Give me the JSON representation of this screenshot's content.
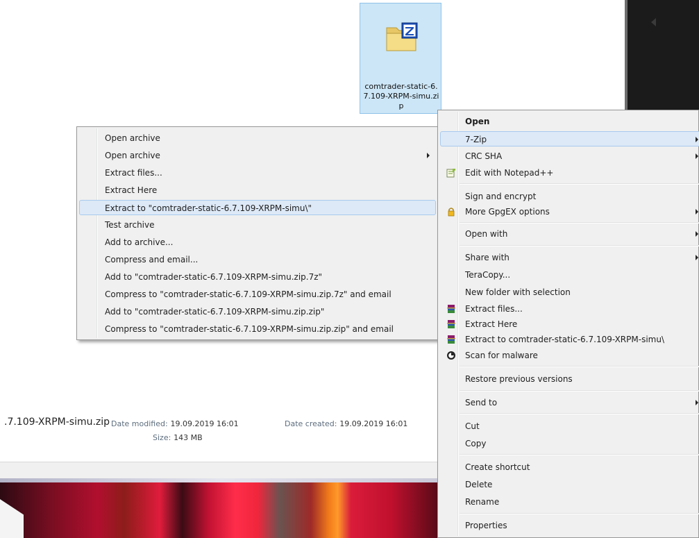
{
  "file": {
    "name": "comtrader-static-6.7.109-XRPM-simu.zip",
    "icon": "zip-archive-icon"
  },
  "details": {
    "name_visible": ".7.109-XRPM-simu.zip",
    "modified_label": "Date modified:",
    "modified_value": "19.09.2019 16:01",
    "created_label": "Date created:",
    "created_value": "19.09.2019 16:01",
    "size_label": "Size:",
    "size_value": "143 MB"
  },
  "context_menu": {
    "items": [
      {
        "label": "Open",
        "bold": true
      },
      {
        "label": "7-Zip",
        "submenu": true,
        "highlighted": true
      },
      {
        "label": "CRC SHA",
        "submenu": true
      },
      {
        "label": "Edit with Notepad++",
        "icon": "notepadpp-icon"
      },
      {
        "label": "Sign and encrypt"
      },
      {
        "label": "More GpgEX options",
        "submenu": true,
        "icon": "lock-icon"
      },
      {
        "label": "Open with",
        "submenu": true
      },
      {
        "label": "Share with",
        "submenu": true
      },
      {
        "label": "TeraCopy..."
      },
      {
        "label": "New folder with selection"
      },
      {
        "label": "Extract files...",
        "icon": "winrar-icon"
      },
      {
        "label": "Extract Here",
        "icon": "winrar-icon"
      },
      {
        "label": "Extract to comtrader-static-6.7.109-XRPM-simu\\",
        "icon": "winrar-icon"
      },
      {
        "label": "Scan for malware",
        "icon": "malwarebytes-icon"
      },
      {
        "label": "Restore previous versions"
      },
      {
        "label": "Send to",
        "submenu": true
      },
      {
        "label": "Cut"
      },
      {
        "label": "Copy"
      },
      {
        "label": "Create shortcut"
      },
      {
        "label": "Delete"
      },
      {
        "label": "Rename"
      },
      {
        "label": "Properties"
      }
    ]
  },
  "submenu_7zip": {
    "items": [
      {
        "label": "Open archive"
      },
      {
        "label": "Open archive",
        "submenu": true
      },
      {
        "label": "Extract files..."
      },
      {
        "label": "Extract Here"
      },
      {
        "label": "Extract to \"comtrader-static-6.7.109-XRPM-simu\\\"",
        "highlighted": true
      },
      {
        "label": "Test archive"
      },
      {
        "label": "Add to archive..."
      },
      {
        "label": "Compress and email..."
      },
      {
        "label": "Add to \"comtrader-static-6.7.109-XRPM-simu.zip.7z\""
      },
      {
        "label": "Compress to \"comtrader-static-6.7.109-XRPM-simu.zip.7z\" and email"
      },
      {
        "label": "Add to \"comtrader-static-6.7.109-XRPM-simu.zip.zip\""
      },
      {
        "label": "Compress to \"comtrader-static-6.7.109-XRPM-simu.zip.zip\" and email"
      }
    ]
  },
  "colors": {
    "menu_bg": "#f0f0f0",
    "highlight_bg": "#dde9f7",
    "highlight_border": "#a8c9ee",
    "selection_bg": "#cce6f7"
  }
}
